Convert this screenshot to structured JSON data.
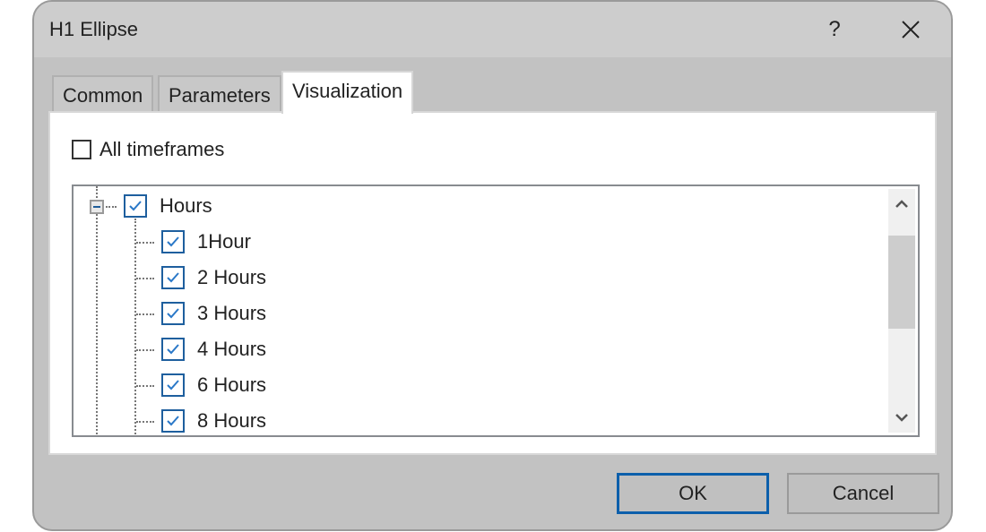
{
  "window": {
    "title": "H1 Ellipse",
    "help_label": "?",
    "close_icon": "close-icon"
  },
  "tabs": [
    {
      "label": "Common",
      "active": false
    },
    {
      "label": "Parameters",
      "active": false
    },
    {
      "label": "Visualization",
      "active": true
    }
  ],
  "visualization": {
    "all_timeframes": {
      "label": "All timeframes",
      "checked": false
    },
    "tree": {
      "root": {
        "label": "Hours",
        "checked": true,
        "expanded": true
      },
      "children": [
        {
          "label": "1Hour",
          "checked": true
        },
        {
          "label": "2 Hours",
          "checked": true
        },
        {
          "label": "3 Hours",
          "checked": true
        },
        {
          "label": "4 Hours",
          "checked": true
        },
        {
          "label": "6 Hours",
          "checked": true
        },
        {
          "label": "8 Hours",
          "checked": true
        }
      ]
    }
  },
  "buttons": {
    "ok": "OK",
    "cancel": "Cancel"
  },
  "colors": {
    "accent": "#0c5fab",
    "checkbox_border": "#1e5f9e",
    "dialog_bg": "#c2c2c2"
  }
}
